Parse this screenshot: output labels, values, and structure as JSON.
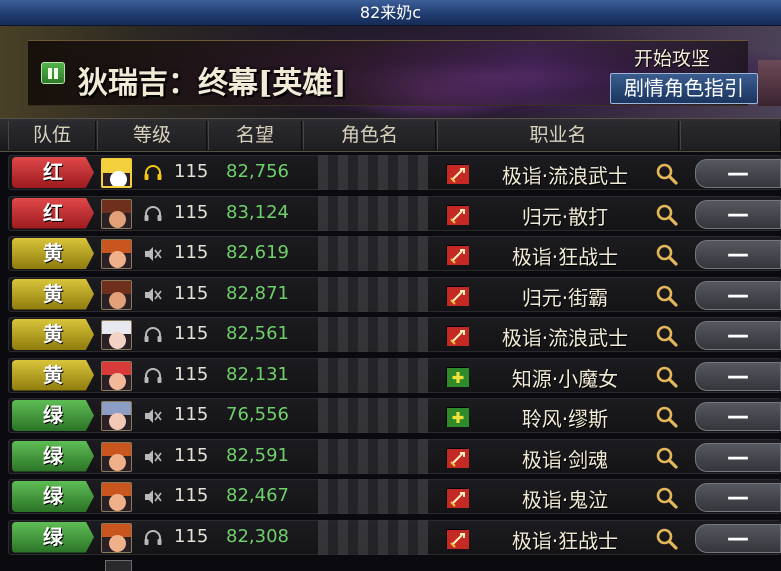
{
  "window": {
    "title": "82来奶c"
  },
  "boss": {
    "name": "狄瑞吉：终幕[英雄]"
  },
  "top_right": {
    "attack_label": "开始攻坚",
    "guide_button": "剧情角色指引"
  },
  "columns": [
    "队伍",
    "等级",
    "名望",
    "角色名",
    "职业名"
  ],
  "colors": {
    "team_red": "#c0262a",
    "team_yellow": "#b8a21a",
    "team_green": "#3e9a3a",
    "fame_green": "#6fd06a"
  },
  "rows": [
    {
      "team": "红",
      "team_color": "red",
      "level": "115",
      "fame": "82,756",
      "class": "极诣·流浪武士",
      "class_icon": "sword-icon",
      "voice_active": true,
      "voice_icon": "headset-icon",
      "avatar": "self",
      "action": "—"
    },
    {
      "team": "红",
      "team_color": "red",
      "level": "115",
      "fame": "83,124",
      "class": "归元·散打",
      "class_icon": "sword-icon",
      "voice_active": false,
      "voice_icon": "headset-icon",
      "avatar": "brown",
      "action": "—"
    },
    {
      "team": "黄",
      "team_color": "yellow",
      "level": "115",
      "fame": "82,619",
      "class": "极诣·狂战士",
      "class_icon": "sword-icon",
      "voice_active": false,
      "voice_icon": "speaker-muted-icon",
      "avatar": "orange",
      "action": "—"
    },
    {
      "team": "黄",
      "team_color": "yellow",
      "level": "115",
      "fame": "82,871",
      "class": "归元·街霸",
      "class_icon": "sword-icon",
      "voice_active": false,
      "voice_icon": "speaker-muted-icon",
      "avatar": "brown",
      "action": "—"
    },
    {
      "team": "黄",
      "team_color": "yellow",
      "level": "115",
      "fame": "82,561",
      "class": "极诣·流浪武士",
      "class_icon": "sword-icon",
      "voice_active": false,
      "voice_icon": "headset-icon",
      "avatar": "white",
      "action": "—"
    },
    {
      "team": "黄",
      "team_color": "yellow",
      "level": "115",
      "fame": "82,131",
      "class": "知源·小魔女",
      "class_icon": "plus-icon",
      "voice_active": false,
      "voice_icon": "headset-icon",
      "avatar": "red",
      "action": "—"
    },
    {
      "team": "绿",
      "team_color": "green",
      "level": "115",
      "fame": "76,556",
      "class": "聆风·缪斯",
      "class_icon": "plus-icon",
      "voice_active": false,
      "voice_icon": "speaker-muted-icon",
      "avatar": "silver",
      "action": "—"
    },
    {
      "team": "绿",
      "team_color": "green",
      "level": "115",
      "fame": "82,591",
      "class": "极诣·剑魂",
      "class_icon": "sword-icon",
      "voice_active": false,
      "voice_icon": "speaker-muted-icon",
      "avatar": "orange",
      "action": "—"
    },
    {
      "team": "绿",
      "team_color": "green",
      "level": "115",
      "fame": "82,467",
      "class": "极诣·鬼泣",
      "class_icon": "sword-icon",
      "voice_active": false,
      "voice_icon": "speaker-muted-icon",
      "avatar": "orange",
      "action": "—"
    },
    {
      "team": "绿",
      "team_color": "green",
      "level": "115",
      "fame": "82,308",
      "class": "极诣·狂战士",
      "class_icon": "sword-icon",
      "voice_active": false,
      "voice_icon": "headset-icon",
      "avatar": "orange",
      "action": "—"
    }
  ]
}
